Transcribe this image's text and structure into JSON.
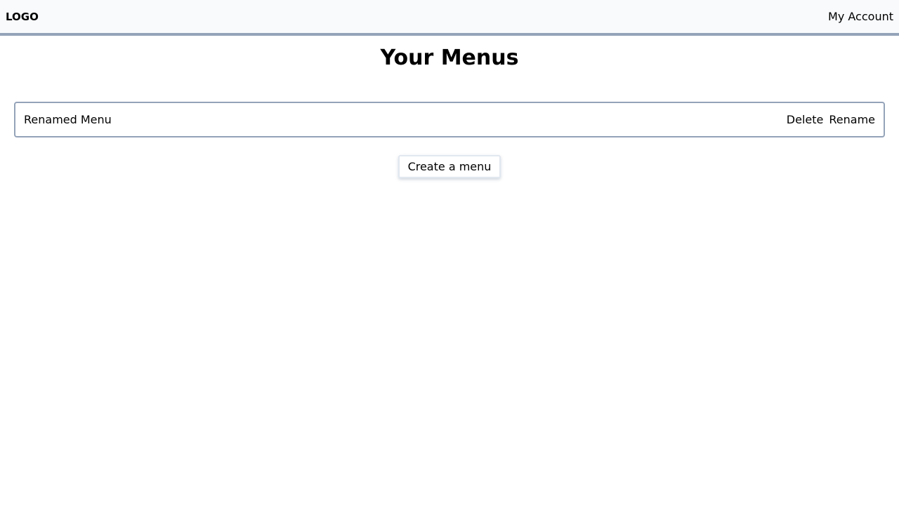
{
  "header": {
    "logo": "LOGO",
    "account": "My Account"
  },
  "page_title": "Your Menus",
  "menus": [
    {
      "name": "Renamed Menu",
      "delete_label": "Delete",
      "rename_label": "Rename"
    }
  ],
  "create_label": "Create a menu"
}
